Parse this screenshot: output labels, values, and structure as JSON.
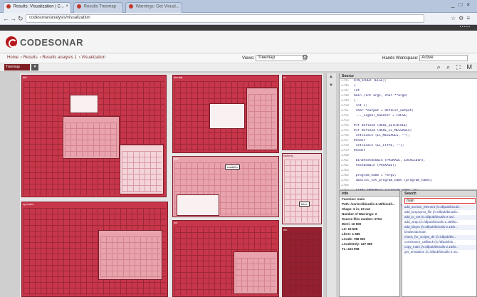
{
  "browser": {
    "tabs": [
      {
        "label": "Results: Visualization | C..."
      },
      {
        "label": "Results Treemap"
      },
      {
        "label": "Warnings: Get Visual..."
      }
    ],
    "url": "codesonar/analysis/visualization"
  },
  "app": {
    "logo": "CODESONAR",
    "breadcrumb": [
      "Home",
      "Results",
      "Results analysis 1",
      "Visualization"
    ],
    "views_label": "Views:",
    "views_value": "Treemap",
    "workspace_label": "Hands Workspace:",
    "workspace_value": "Active",
    "treemap_button": "Treemap"
  },
  "source": {
    "title": "Source",
    "lines": [
      {
        "n": "2745",
        "t": "RTN_OTHER (ELSE);"
      },
      {
        "n": "2746",
        "t": "}"
      },
      {
        "n": "2747",
        "t": "int"
      },
      {
        "n": "2748",
        "t": "main (int argc, char **argv)"
      },
      {
        "n": "2749",
        "t": "{"
      },
      {
        "n": "2750",
        "t": "  int i;"
      },
      {
        "n": "2751",
        "t": "  char *output = default_output;"
      },
      {
        "n": "2752",
        "t": "  ..._signal_handler = FALSE;"
      },
      {
        "n": "2753",
        "t": ""
      },
      {
        "n": "2754",
        "t": "#if defined (HAVE_SETLOCALE)"
      },
      {
        "n": "2755",
        "t": "#if defined (HAVE_LC_MESSAGES)"
      },
      {
        "n": "2756",
        "t": "  setlocale (LC_MESSAGES, \"\");"
      },
      {
        "n": "2757",
        "t": "#endif"
      },
      {
        "n": "2758",
        "t": "  setlocale (LC_CTYPE, \"\");"
      },
      {
        "n": "2759",
        "t": "#endif"
      },
      {
        "n": "2760",
        "t": ""
      },
      {
        "n": "2761",
        "t": "  bindtextdomain (PACKAGE, LOCALEDIR);"
      },
      {
        "n": "2762",
        "t": "  textdomain (PACKAGE);"
      },
      {
        "n": "2763",
        "t": ""
      },
      {
        "n": "2764",
        "t": "  program_name = *argv;"
      },
      {
        "n": "2765",
        "t": "  xmalloc_set_program_name (program_name);"
      },
      {
        "n": "2766",
        "t": ""
      },
      {
        "n": "2767",
        "t": "  START_PROGRESS (program_name, 0);"
      },
      {
        "n": "2768",
        "t": ""
      },
      {
        "n": "2769",
        "t": "  bfd_init ();"
      },
      {
        "n": "2770",
        "t": "  set_default_bfd_target ();"
      },
      {
        "n": "2771",
        "t": ""
      },
      {
        "n": "2772",
        "t": "  while ((c = getopt_long (argc, argv,"
      }
    ]
  },
  "info": {
    "title": "Info",
    "lines": [
      "Function: main",
      "Path: /usr/src/binutils-2.16/binutil...",
      "Shape: 6 in; 23 out",
      "Number of Warnings: 2",
      "Source files number: 2794",
      "McCi: 16 500",
      "LS: 15 508",
      "LkCC: 1 685",
      "LCode: 788 050",
      "LCodeOnly: 327 089",
      "TL: 224 908"
    ]
  },
  "search": {
    "title": "Search",
    "query": "main",
    "results": [
      "add_archive_element (/c:/dfpub/binutil...",
      "add_keepsyms_file (/c:/dfpub/binutils...",
      "add_to_set (/c:/dfpub/binutils-2.16/...",
      "add_wrap (/c:/dfpub/binutils-2.16/bfd...",
      "add_ldsym (/c:/dfpub/binutils-2.16/b...",
      "bindtextdomain",
      "check_for_scripts_dir (/c:/dfpub/bin...",
      "constructor_callback (/c:/dfpub/bin...",
      "copy_main (/c:/dfpub/binutils-2.16/bi...",
      "get_emulation (/c:/dfpub/binutils-2.16..."
    ]
  },
  "treemap": {
    "labels": [
      "bfd",
      "binutils",
      "ld",
      "gas",
      "libiberty",
      "opcodes",
      "intl",
      "etc"
    ],
    "tags": [
      "readelf.c",
      "bfd.c"
    ]
  }
}
